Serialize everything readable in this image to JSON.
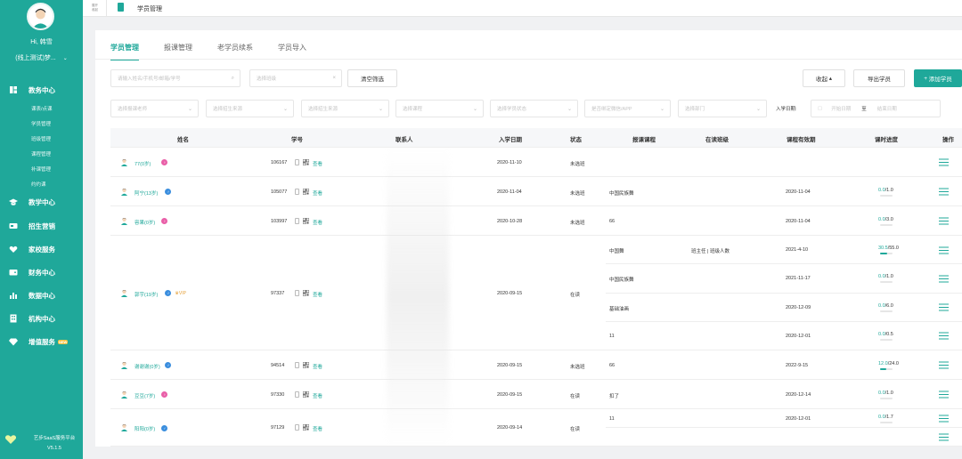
{
  "sidebar": {
    "greeting": "Hi, 韩雪",
    "org": "(线上测试)梦...",
    "nav": [
      {
        "label": "教务中心",
        "icon": "grid-icon"
      },
      {
        "label": "教学中心",
        "icon": "graduation-cap-icon"
      },
      {
        "label": "招生营销",
        "icon": "card-icon"
      },
      {
        "label": "家校服务",
        "icon": "heart-icon"
      },
      {
        "label": "财务中心",
        "icon": "wallet-icon"
      },
      {
        "label": "数据中心",
        "icon": "bar-chart-icon"
      },
      {
        "label": "机构中心",
        "icon": "building-icon"
      },
      {
        "label": "增值服务",
        "icon": "diamond-icon",
        "badge": "NEW"
      }
    ],
    "sub_items": [
      "课表/点课",
      "学员管理",
      "班级管理",
      "课程管理",
      "补课管理",
      "约约课"
    ],
    "footer_title": "艺步SaaS服务平台",
    "footer_version": "V5.1.5"
  },
  "topbar": {
    "fold_label": "展开收起",
    "breadcrumb": "学员管理"
  },
  "tabs": [
    "学员管理",
    "报课管理",
    "老学员续系",
    "学员导入"
  ],
  "filters": {
    "search_placeholder": "请输入姓名/手机号/邮箱/学号",
    "class_placeholder": "选择班级",
    "clear_label": "清空筛选",
    "collapse_label": "收起",
    "export_label": "导出学员",
    "add_label": "添加学员",
    "row2": [
      "选择报课老师",
      "选择招生来源",
      "选择招生来源",
      "选择课程",
      "选择学员状态",
      "是否绑定微信/APP",
      "选择部门"
    ],
    "enroll_date_label": "入学日期:",
    "start_date": "开始日期",
    "to": "至",
    "end_date": "结束日期"
  },
  "table": {
    "headers": [
      "姓名",
      "学号",
      "联系人",
      "入学日期",
      "状态",
      "报课课程",
      "在读班级",
      "课程有效期",
      "课时进度",
      "操作"
    ],
    "view_label": "查看",
    "students": [
      {
        "name": "77(0岁)",
        "gender": "f",
        "id": "106167",
        "date": "2020-11-10",
        "status": "未选班",
        "vip": "",
        "courses": [
          {
            "course": "",
            "class": "",
            "expire": "",
            "done": "",
            "total": "",
            "pct": 0
          }
        ]
      },
      {
        "name": "阿宁(13岁)",
        "gender": "m",
        "id": "105077",
        "date": "2020-11-04",
        "status": "未选班",
        "vip": "",
        "courses": [
          {
            "course": "中国民族舞",
            "class": "",
            "expire": "2020-11-04",
            "done": "0.0",
            "total": "/1.0",
            "pct": 0
          }
        ]
      },
      {
        "name": "容果(0岁)",
        "gender": "f",
        "id": "103997",
        "date": "2020-10-28",
        "status": "未选班",
        "vip": "",
        "courses": [
          {
            "course": "66",
            "class": "",
            "expire": "2020-11-04",
            "done": "0.0",
            "total": "/3.0",
            "pct": 0
          }
        ]
      },
      {
        "name": "郭宇(19岁)",
        "gender": "m",
        "id": "97337",
        "date": "2020-09-15",
        "status": "在读",
        "vip": "VIP",
        "courses": [
          {
            "course": "中国舞",
            "class": "班主任 | 班级人数",
            "expire": "2021-4-10",
            "done": "30.5",
            "total": "/55.0",
            "pct": 0.55
          },
          {
            "course": "中国民族舞",
            "class": "",
            "expire": "2021-11-17",
            "done": "0.0",
            "total": "/1.0",
            "pct": 0
          },
          {
            "course": "基础油画",
            "class": "",
            "expire": "2020-12-09",
            "done": "0.0",
            "total": "/6.0",
            "pct": 0
          },
          {
            "course": "11",
            "class": "",
            "expire": "2020-12-01",
            "done": "0.0",
            "total": "/0.5",
            "pct": 0
          }
        ]
      },
      {
        "name": "谢谢谢(0岁)",
        "gender": "m",
        "id": "94514",
        "date": "2020-09-15",
        "status": "未选班",
        "vip": "",
        "courses": [
          {
            "course": "66",
            "class": "",
            "expire": "2022-9-15",
            "done": "12.0",
            "total": "/24.0",
            "pct": 0.5
          }
        ]
      },
      {
        "name": "豆豆(7岁)",
        "gender": "f",
        "id": "97330",
        "date": "2020-09-15",
        "status": "在读",
        "vip": "",
        "courses": [
          {
            "course": "扣了",
            "class": "",
            "expire": "2020-12-14",
            "done": "0.0",
            "total": "/1.0",
            "pct": 0
          }
        ]
      },
      {
        "name": "阳阳(0岁)",
        "gender": "m",
        "id": "97129",
        "date": "2020-09-14",
        "status": "在读",
        "vip": "",
        "courses": [
          {
            "course": "11",
            "class": "",
            "expire": "2020-12-01",
            "done": "0.0",
            "total": "/1.7",
            "pct": 0
          },
          {
            "course": "",
            "class": "",
            "expire": "",
            "done": "",
            "total": "",
            "pct": 0
          }
        ]
      }
    ]
  },
  "colors": {
    "accent": "#1fa89a",
    "female": "#e95fa8",
    "male": "#3b8ede"
  }
}
